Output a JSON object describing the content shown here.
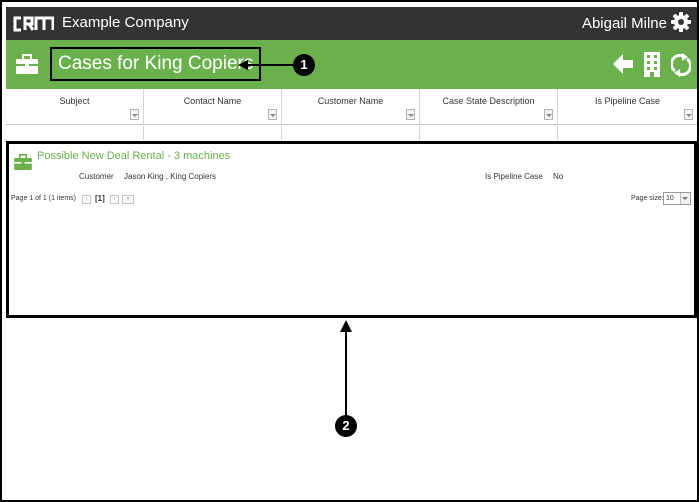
{
  "topbar": {
    "logo_text": "CRM",
    "company_name": "Example Company",
    "user_name": "Abigail Milne",
    "settings_icon": "gear-icon"
  },
  "header": {
    "icon": "briefcase-icon",
    "title": "Cases for King Copiers",
    "actions": [
      "back-arrow-icon",
      "building-icon",
      "refresh-icon"
    ],
    "accent_color": "#6ab04c"
  },
  "grid": {
    "columns": [
      {
        "label": "Subject"
      },
      {
        "label": "Contact Name"
      },
      {
        "label": "Customer Name"
      },
      {
        "label": "Case State Description"
      },
      {
        "label": "Is Pipeline Case"
      }
    ]
  },
  "results": {
    "items": [
      {
        "title": "Possible New Deal Rental - 3 machines",
        "customer_label": "Customer",
        "customer_value": "Jason King , King Copiers",
        "pipeline_label": "Is Pipeline Case",
        "pipeline_value": "No"
      }
    ],
    "pager": {
      "summary": "Page 1 of 1 (1 items)",
      "current_page": "[1]",
      "page_size_label": "Page size:",
      "page_size_value": "10"
    }
  },
  "callouts": [
    {
      "number": "1"
    },
    {
      "number": "2"
    }
  ]
}
